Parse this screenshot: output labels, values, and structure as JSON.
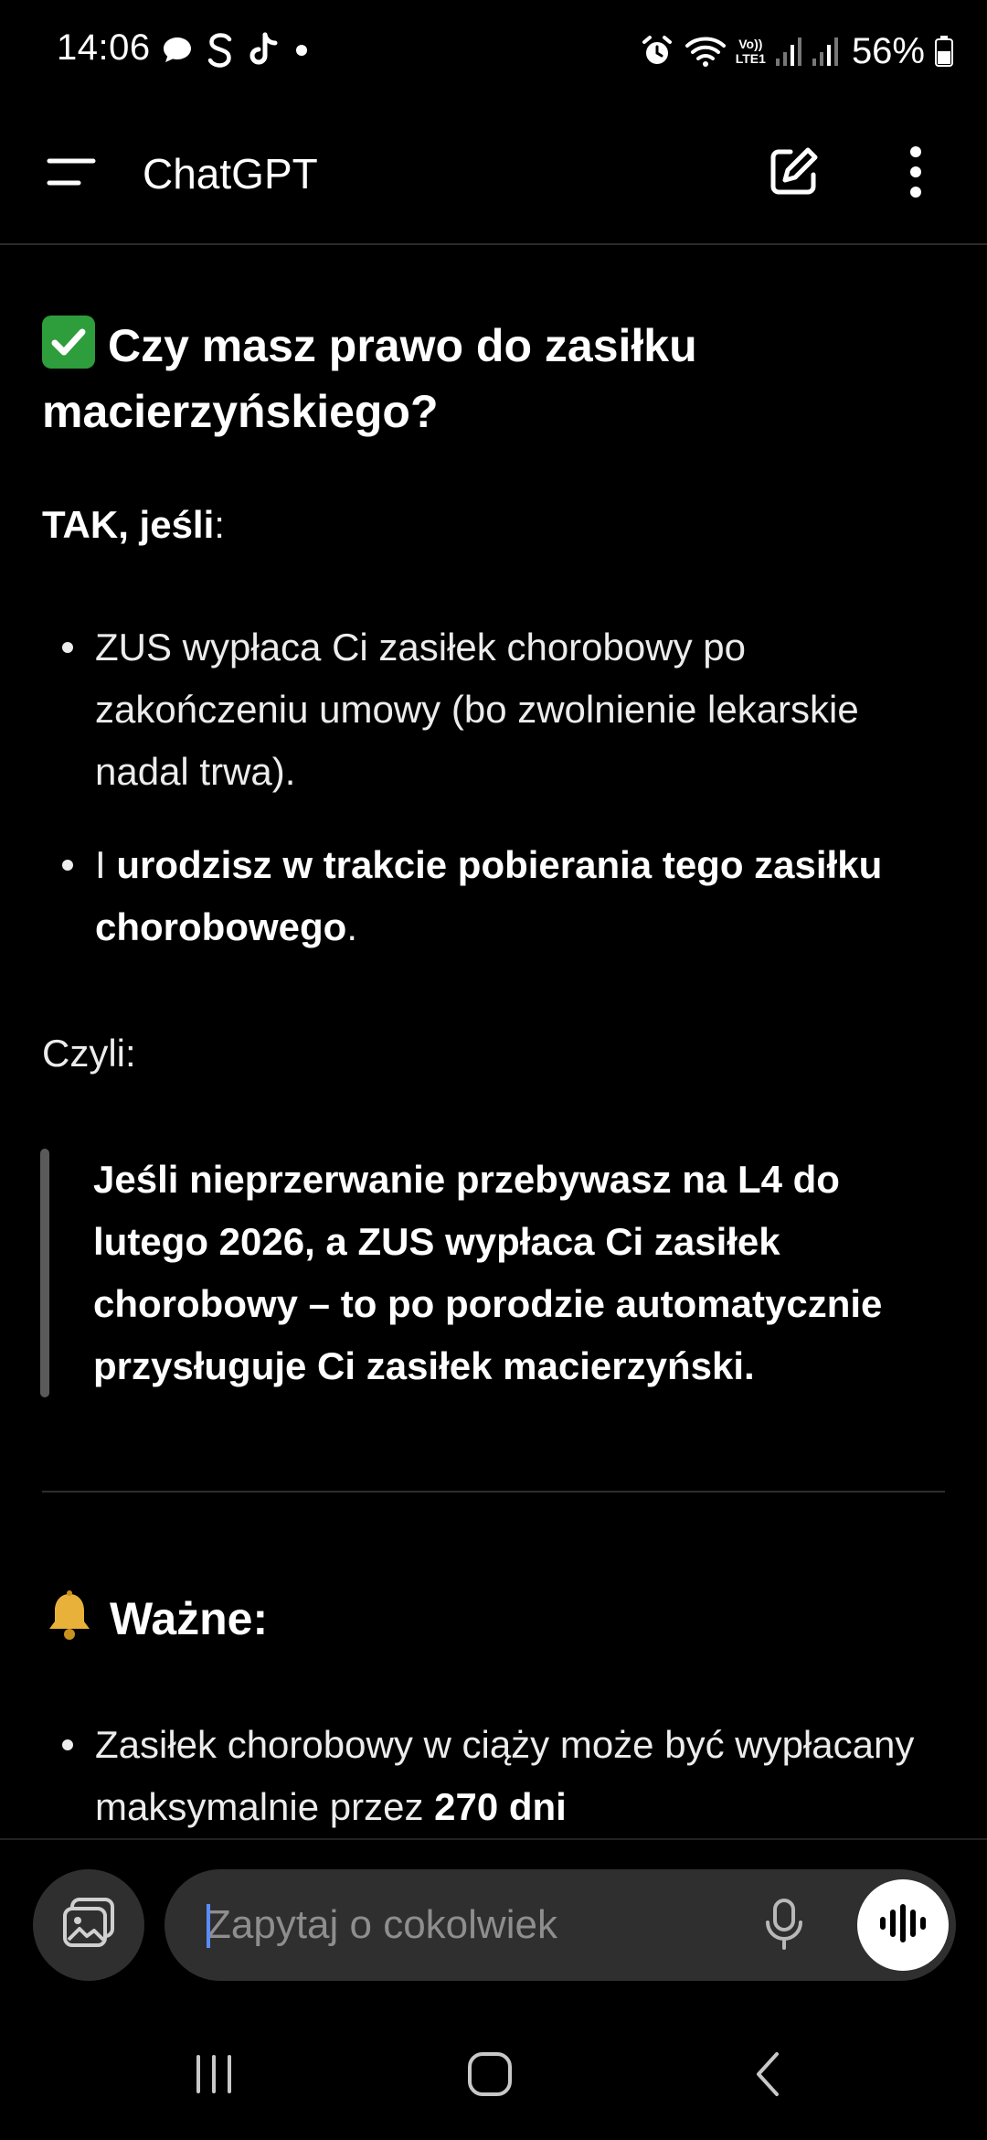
{
  "status_bar": {
    "time": "14:06",
    "left_icons": [
      "chat-bubble-icon",
      "s-app-icon",
      "tiktok-icon",
      "dot-icon"
    ],
    "right_icons": [
      "alarm-icon",
      "wifi-icon",
      "volte-icon",
      "signal-icon",
      "signal-icon",
      "battery-icon"
    ],
    "volte_label_top": "Vo))",
    "volte_label_bottom": "LTE1",
    "battery": "56%"
  },
  "header": {
    "title": "ChatGPT",
    "icons": [
      "menu-icon",
      "new-chat-icon",
      "more-vertical-icon"
    ]
  },
  "message": {
    "heading": "Czy masz prawo do zasiłku macierzyńskiego?",
    "heading_icon": "check-mark-emoji",
    "tak_bold": "TAK, jeśli",
    "tak_colon": ":",
    "bullets": [
      {
        "text": "ZUS wypłaca Ci zasiłek chorobowy po zakończeniu umowy (bo zwolnienie lekarskie nadal trwa)."
      },
      {
        "prefix": "I ",
        "bold": "urodzisz w trakcie pobierania tego zasiłku chorobowego",
        "suffix": "."
      }
    ],
    "czyli": "Czyli:",
    "quote": "Jeśli nieprzerwanie przebywasz na L4 do lutego 2026, a ZUS wypłaca Ci zasiłek chorobowy – to po porodzie automatycznie przysługuje Ci zasiłek macierzyński.",
    "subheading": "Ważne:",
    "subheading_icon": "bell-emoji",
    "important_bullets": [
      {
        "text": "Zasiłek chorobowy w ciąży może być wypłacany maksymalnie przez ",
        "bold": "270 dni"
      }
    ]
  },
  "composer": {
    "placeholder": "Zapytaj o cokolwiek",
    "icons": [
      "attach-image-icon",
      "microphone-icon",
      "voice-mode-icon"
    ]
  },
  "nav_bar": {
    "icons": [
      "recent-apps-icon",
      "home-icon",
      "back-icon"
    ]
  },
  "colors": {
    "background": "#000000",
    "text": "#ececec",
    "input_bg": "#2f2f2f",
    "check_green": "#2e9d3c",
    "quote_bar": "#5a5a5a"
  }
}
